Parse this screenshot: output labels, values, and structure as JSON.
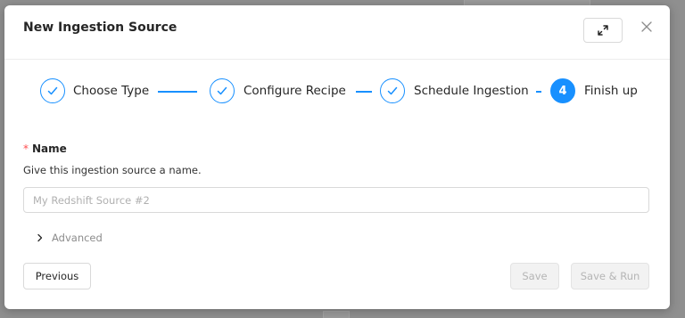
{
  "modal": {
    "title": "New Ingestion Source",
    "expand_icon": "expand-arrows-icon",
    "close_icon": "close-x-icon"
  },
  "steps": [
    {
      "label": "Choose Type",
      "status": "done",
      "icon": "check-icon"
    },
    {
      "label": "Configure Recipe",
      "status": "done",
      "icon": "check-icon"
    },
    {
      "label": "Schedule Ingestion",
      "status": "done",
      "icon": "check-icon"
    },
    {
      "label": "Finish up",
      "status": "active",
      "number": "4"
    }
  ],
  "form": {
    "required_marker": "*",
    "name_label": "Name",
    "name_help": "Give this ingestion source a name.",
    "name_placeholder": "My Redshift Source #2",
    "name_value": "",
    "advanced_label": "Advanced",
    "advanced_icon": "chevron-right-icon"
  },
  "footer": {
    "previous_label": "Previous",
    "save_label": "Save",
    "save_run_label": "Save & Run"
  },
  "colors": {
    "accent": "#1890ff",
    "required": "#ff4d4f",
    "disabled_text": "#b5b5b5",
    "overlay": "#8f8f8f"
  }
}
